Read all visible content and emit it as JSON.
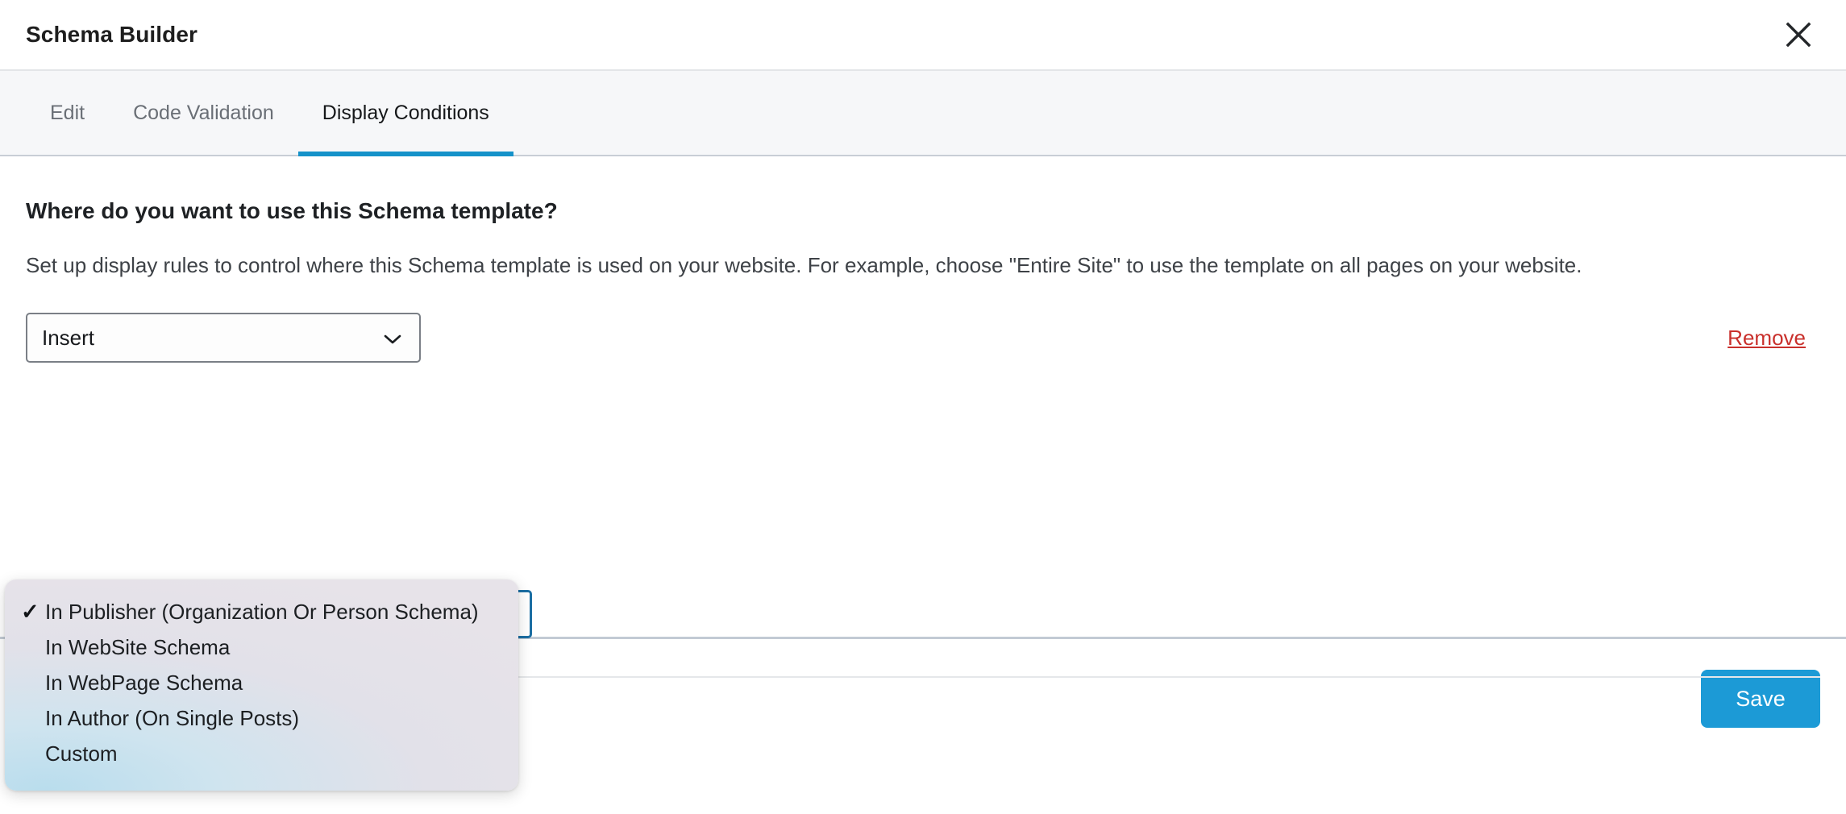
{
  "header": {
    "title": "Schema Builder",
    "close_icon": "close-icon"
  },
  "tabs": [
    {
      "label": "Edit",
      "active": false
    },
    {
      "label": "Code Validation",
      "active": false
    },
    {
      "label": "Display Conditions",
      "active": true
    }
  ],
  "body": {
    "heading": "Where do you want to use this Schema template?",
    "description": "Set up display rules to control where this Schema template is used on your website. For example, choose \"Entire Site\" to use the template on all pages on your website.",
    "rule": {
      "select_value": "Insert",
      "chevron_icon": "chevron-down-icon",
      "remove_label": "Remove"
    },
    "hidden_button_label": ""
  },
  "dropdown": {
    "check_glyph": "✓",
    "options": [
      {
        "label": "In Publisher (Organization Or Person Schema)",
        "selected": true
      },
      {
        "label": "In WebSite Schema",
        "selected": false
      },
      {
        "label": "In WebPage Schema",
        "selected": false
      },
      {
        "label": "In Author (On Single Posts)",
        "selected": false
      },
      {
        "label": "Custom",
        "selected": false
      }
    ]
  },
  "footer": {
    "save_label": "Save"
  },
  "colors": {
    "accent_blue": "#1592c9",
    "save_blue": "#1c9ad6",
    "remove_red": "#c9302c",
    "outline_blue": "#1b6ea3",
    "tabbar_bg": "#f6f7f9"
  }
}
